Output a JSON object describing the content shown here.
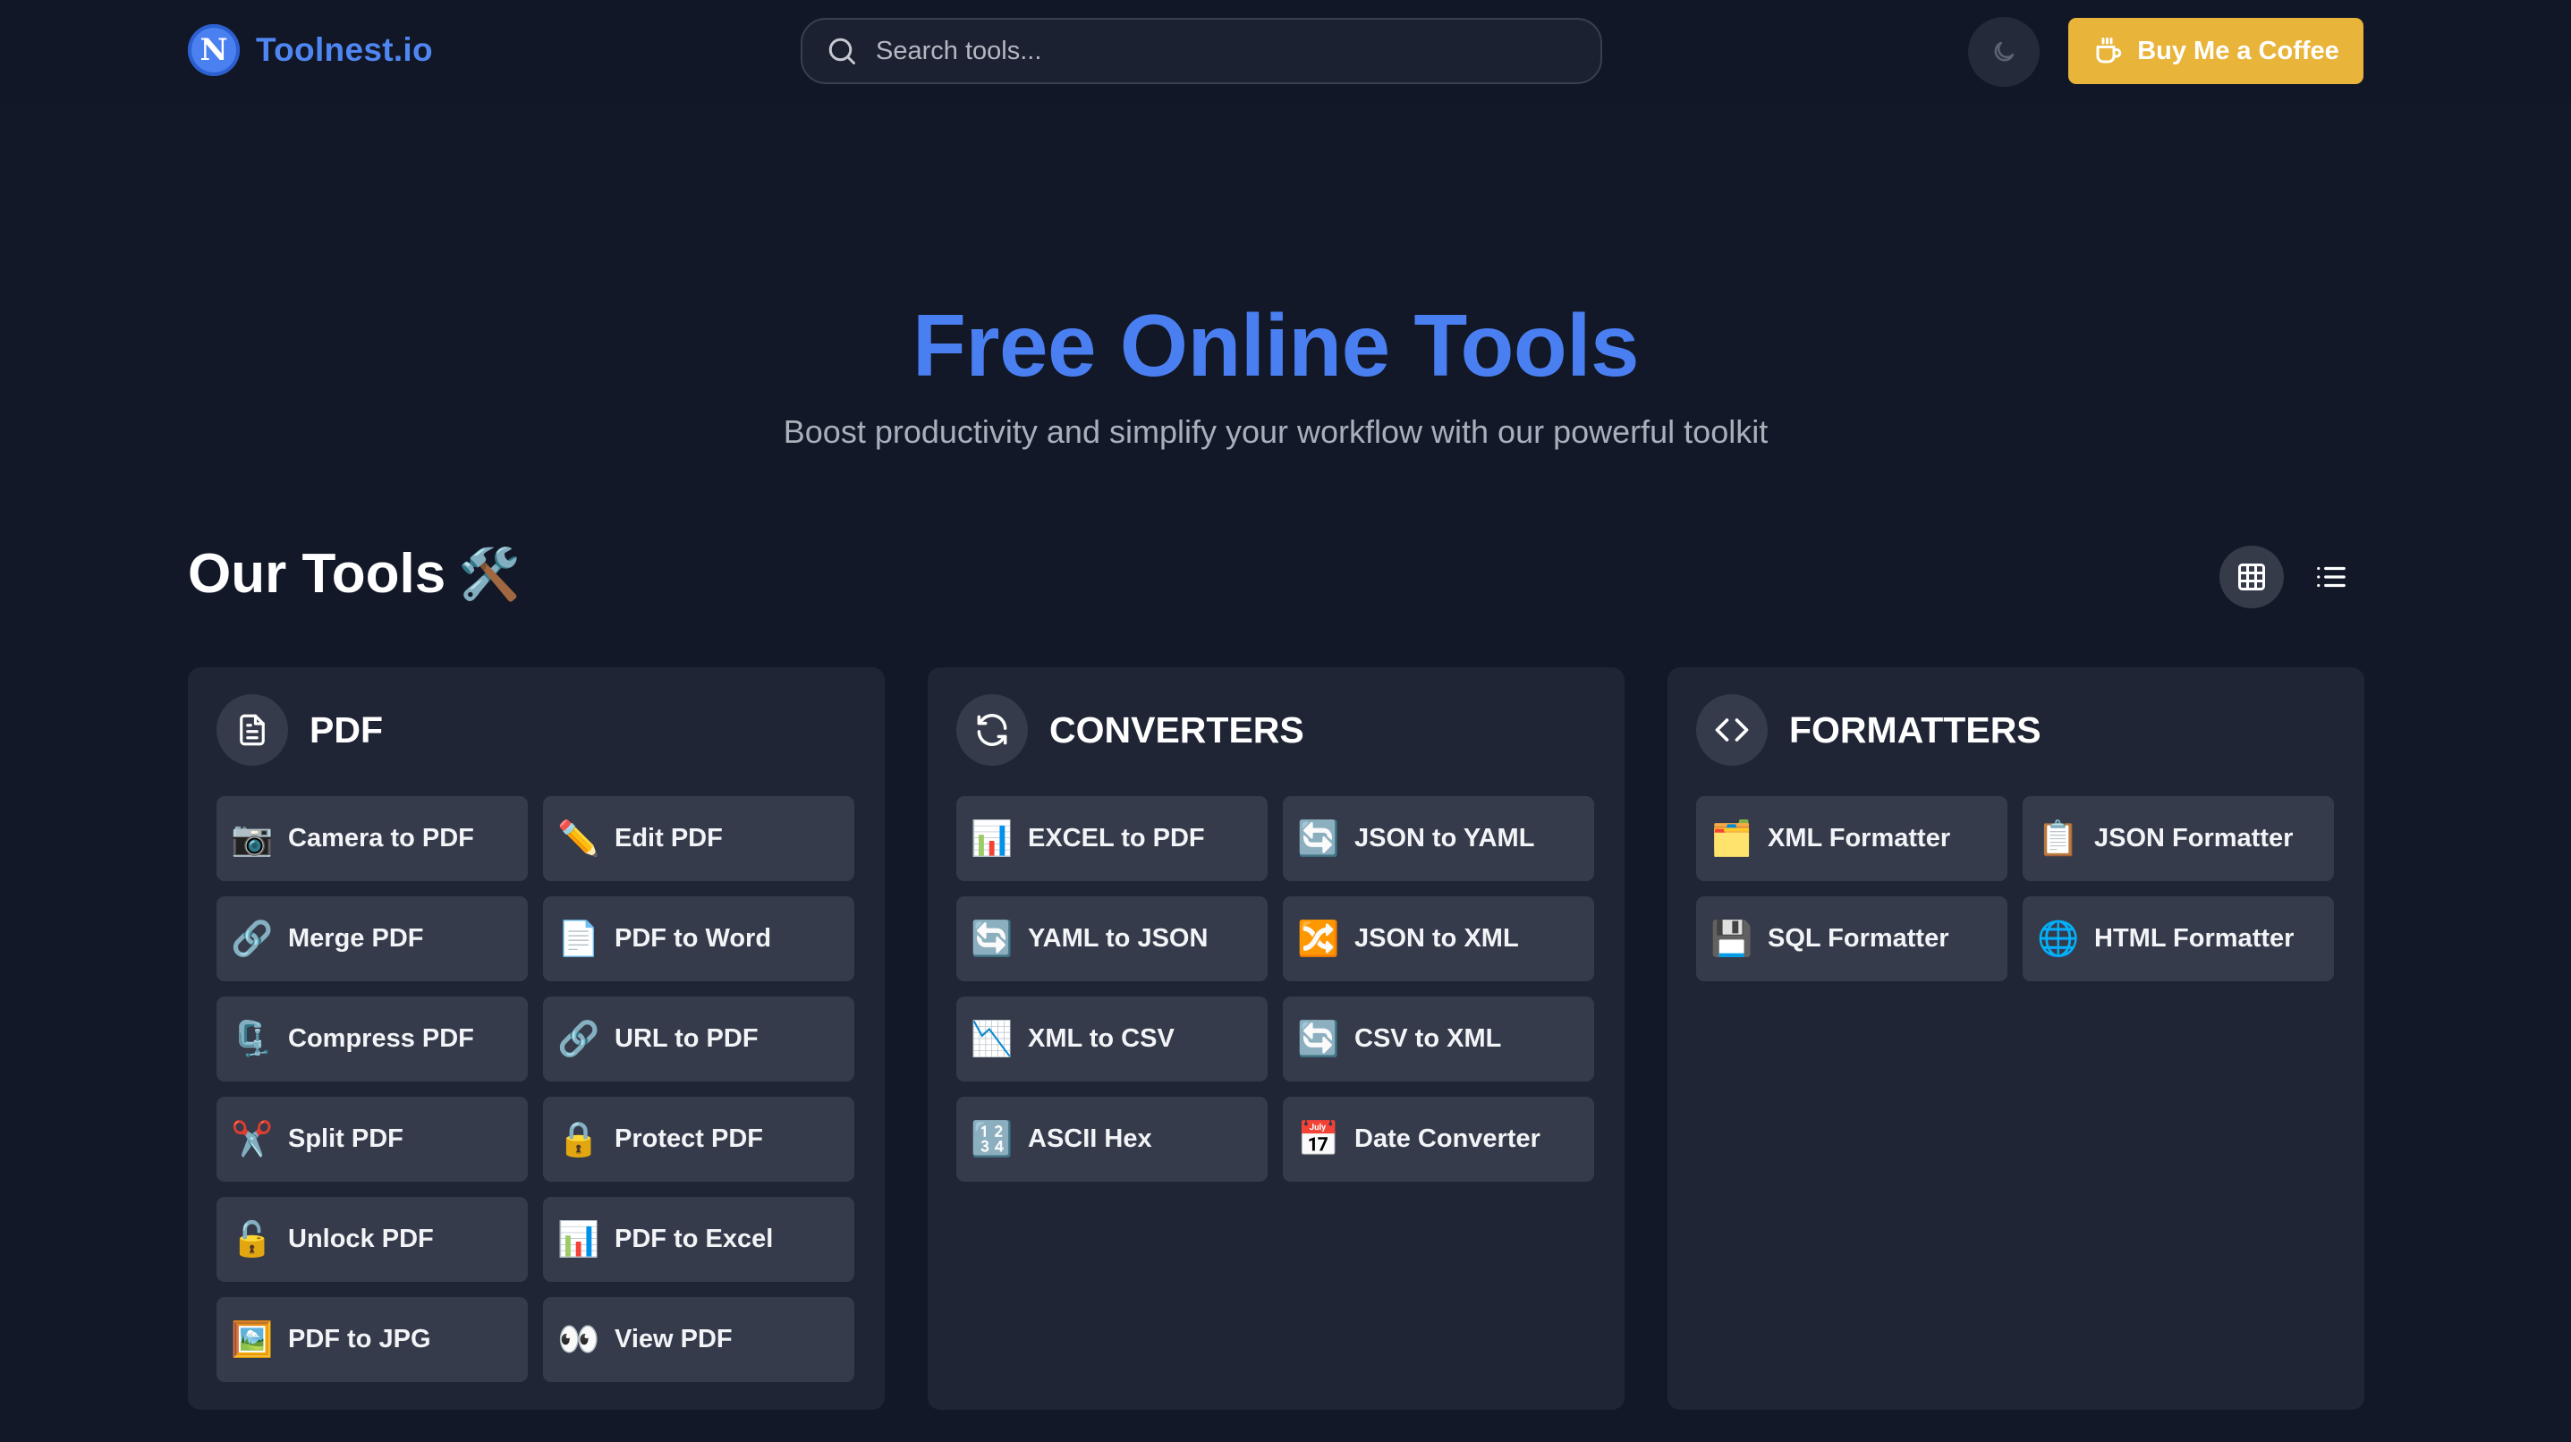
{
  "header": {
    "brand_logo_letter": "N",
    "brand_name": "Toolnest.io",
    "search_placeholder": "Search tools...",
    "theme_toggle_icon": "moon-icon",
    "coffee_label": "Buy Me a Coffee",
    "coffee_icon": "coffee-cup-icon"
  },
  "hero": {
    "title": "Free Online Tools",
    "subtitle": "Boost productivity and simplify your workflow with our powerful toolkit"
  },
  "tools_section": {
    "heading": "Our Tools",
    "heading_emoji": "🛠️",
    "view_grid_icon": "grid-view-icon",
    "view_list_icon": "list-view-icon",
    "active_view": "grid"
  },
  "categories": [
    {
      "title": "PDF",
      "icon": "file-text-icon",
      "tools": [
        {
          "label": "Camera to PDF",
          "emoji": "📷"
        },
        {
          "label": "Edit PDF",
          "emoji": "✏️"
        },
        {
          "label": "Merge PDF",
          "emoji": "🔗"
        },
        {
          "label": "PDF to Word",
          "emoji": "📄"
        },
        {
          "label": "Compress PDF",
          "emoji": "🗜️"
        },
        {
          "label": "URL to PDF",
          "emoji": "🔗"
        },
        {
          "label": "Split PDF",
          "emoji": "✂️"
        },
        {
          "label": "Protect PDF",
          "emoji": "🔒"
        },
        {
          "label": "Unlock PDF",
          "emoji": "🔓"
        },
        {
          "label": "PDF to Excel",
          "emoji": "📊"
        },
        {
          "label": "PDF to JPG",
          "emoji": "🖼️"
        },
        {
          "label": "View PDF",
          "emoji": "👀"
        }
      ]
    },
    {
      "title": "CONVERTERS",
      "icon": "refresh-icon",
      "tools": [
        {
          "label": "EXCEL to PDF",
          "emoji": "📊"
        },
        {
          "label": "JSON to YAML",
          "emoji": "🔄"
        },
        {
          "label": "YAML to JSON",
          "emoji": "🔄"
        },
        {
          "label": "JSON to XML",
          "emoji": "🔀"
        },
        {
          "label": "XML to CSV",
          "emoji": "📉"
        },
        {
          "label": "CSV to XML",
          "emoji": "🔄"
        },
        {
          "label": "ASCII Hex",
          "emoji": "🔢"
        },
        {
          "label": "Date Converter",
          "emoji": "📅"
        }
      ]
    },
    {
      "title": "FORMATTERS",
      "icon": "code-brackets-icon",
      "tools": [
        {
          "label": "XML Formatter",
          "emoji": "🗂️"
        },
        {
          "label": "JSON Formatter",
          "emoji": "📋"
        },
        {
          "label": "SQL Formatter",
          "emoji": "💾"
        },
        {
          "label": "HTML Formatter",
          "emoji": "🌐"
        }
      ]
    }
  ],
  "colors": {
    "background": "#121827",
    "card": "#1f2535",
    "tile": "#353b4a",
    "accent_blue": "#4a7ff1",
    "coffee_yellow": "#e9b43a"
  }
}
